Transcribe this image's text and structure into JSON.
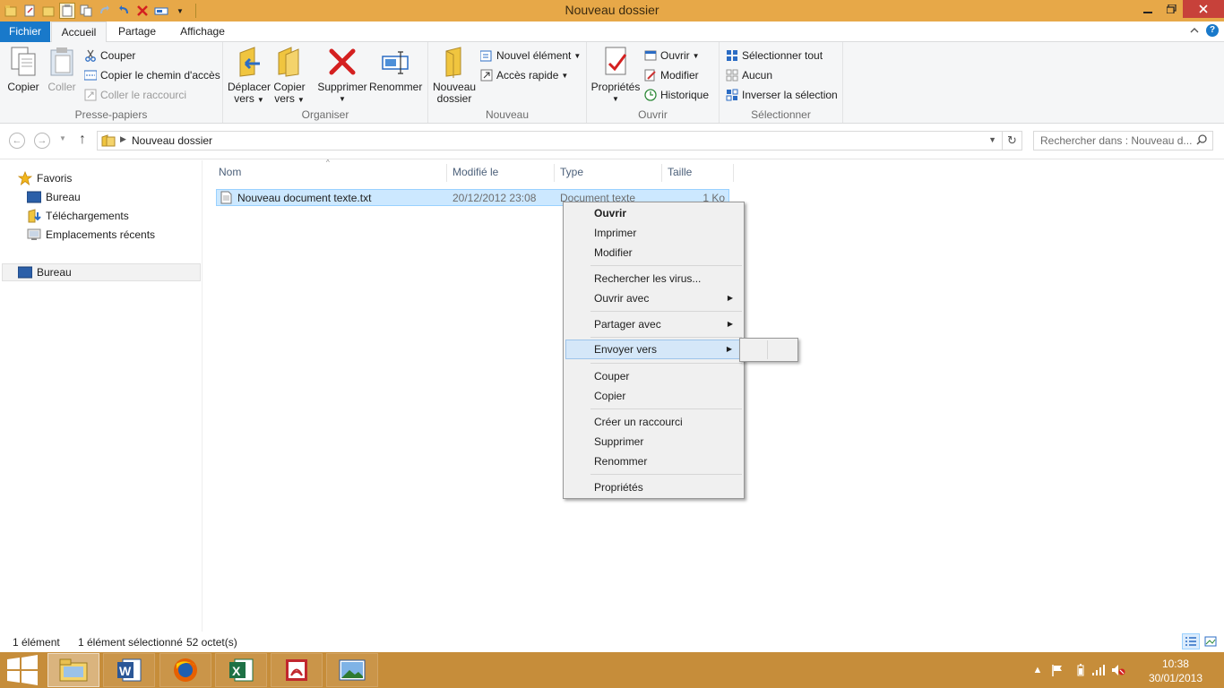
{
  "window": {
    "title": "Nouveau dossier",
    "min_icon": "minimize-icon",
    "max_icon": "maximize-icon",
    "close_icon": "close-icon"
  },
  "tabs": {
    "fichier": "Fichier",
    "accueil": "Accueil",
    "partage": "Partage",
    "affichage": "Affichage"
  },
  "ribbon": {
    "clipboard": {
      "label": "Presse-papiers",
      "copier": "Copier",
      "coller": "Coller",
      "couper": "Couper",
      "copier_chemin": "Copier le chemin d'accès",
      "coller_raccourci": "Coller le raccourci"
    },
    "organiser": {
      "label": "Organiser",
      "deplacer_1": "Déplacer",
      "deplacer_2": "vers",
      "copier_1": "Copier",
      "copier_2": "vers",
      "supprimer": "Supprimer",
      "renommer": "Renommer"
    },
    "nouveau": {
      "label": "Nouveau",
      "dossier_1": "Nouveau",
      "dossier_2": "dossier",
      "nouvel_element": "Nouvel élément",
      "acces_rapide": "Accès rapide"
    },
    "ouvrir": {
      "label": "Ouvrir",
      "proprietes": "Propriétés",
      "ouvrir": "Ouvrir",
      "modifier": "Modifier",
      "historique": "Historique"
    },
    "selection": {
      "label": "Sélectionner",
      "tout": "Sélectionner tout",
      "aucun": "Aucun",
      "inverser": "Inverser la sélection"
    }
  },
  "address": {
    "crumb": "Nouveau dossier",
    "search_placeholder": "Rechercher dans : Nouveau d..."
  },
  "nav": {
    "favoris": "Favoris",
    "bureau": "Bureau",
    "telechargements": "Téléchargements",
    "emplacements": "Emplacements récents",
    "bureau_root": "Bureau"
  },
  "columns": {
    "nom": "Nom",
    "modifie": "Modifié le",
    "type": "Type",
    "taille": "Taille"
  },
  "file": {
    "name": "Nouveau document texte.txt",
    "date": "20/12/2012 23:08",
    "type": "Document texte",
    "size": "1 Ko"
  },
  "context_menu": {
    "ouvrir": "Ouvrir",
    "imprimer": "Imprimer",
    "modifier": "Modifier",
    "virus": "Rechercher les virus...",
    "ouvrir_avec": "Ouvrir avec",
    "partager": "Partager avec",
    "envoyer": "Envoyer vers",
    "couper": "Couper",
    "copier": "Copier",
    "raccourci": "Créer un raccourci",
    "supprimer": "Supprimer",
    "renommer": "Renommer",
    "proprietes": "Propriétés"
  },
  "status": {
    "count": "1 élément",
    "selected": "1 élément sélectionné",
    "size": "52 octet(s)"
  },
  "taskbar": {
    "time": "10:38",
    "date": "30/01/2013"
  },
  "colors": {
    "titlebar": "#e7a848",
    "taskbar": "#c68d3a",
    "accent": "#1979ca",
    "selection": "#cce8ff"
  }
}
